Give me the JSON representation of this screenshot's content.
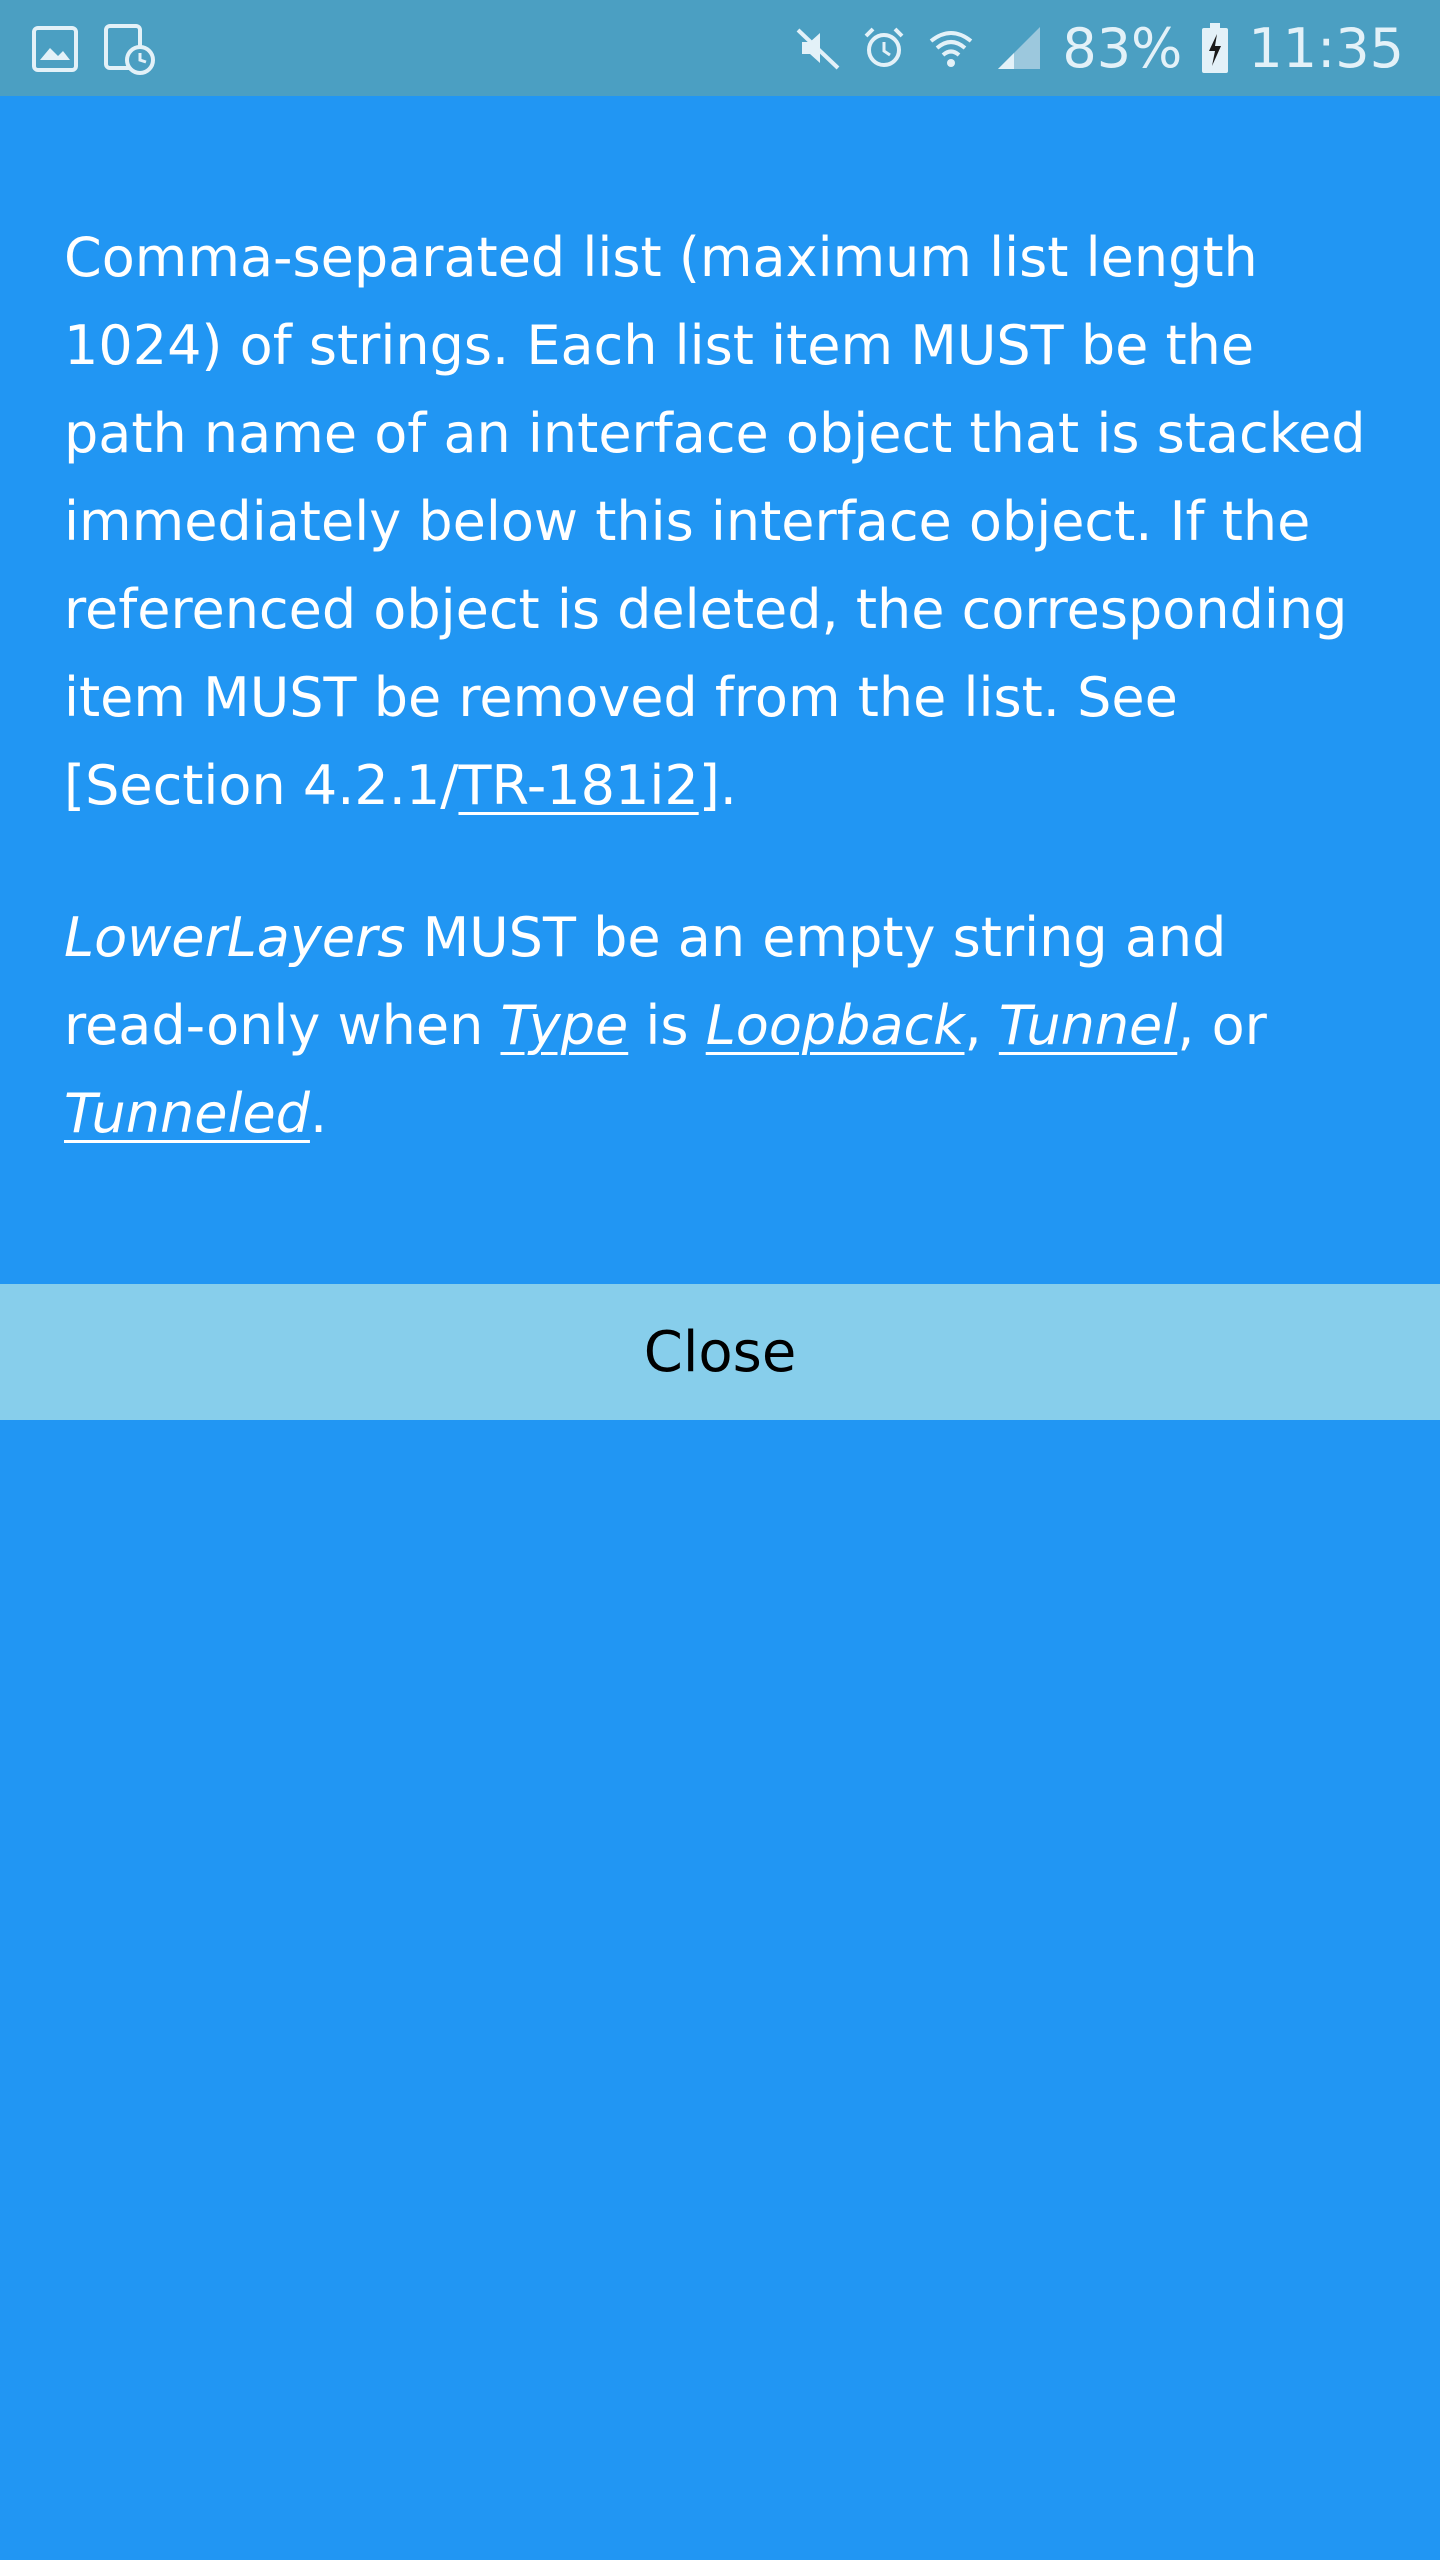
{
  "status_bar": {
    "battery_percent": "83%",
    "time": "11:35",
    "icons_left": [
      "gallery-icon",
      "screenshot-schedule-icon"
    ],
    "icons_right": [
      "mute-icon",
      "alarm-icon",
      "wifi-icon",
      "signal-icon",
      "battery-charging-icon"
    ]
  },
  "description": {
    "p1": {
      "text_main": "Comma-separated list (maximum list length 1024) of strings. Each list item MUST be the path name of an interface object that is stacked immediately below this interface object. If the referenced object is deleted, the corresponding item MUST be removed from the list. See [Section 4.2.1/",
      "link": "TR-181i2",
      "text_end": "]."
    },
    "p2": {
      "param_name": "LowerLayers",
      "text_a": " MUST be an empty string and read-only when ",
      "type_link": "Type",
      "text_b": " is ",
      "loopback_link": "Loopback",
      "comma1": ", ",
      "tunnel_link": "Tunnel",
      "text_c": ", or ",
      "tunneled_link": "Tunneled",
      "period": "."
    }
  },
  "close_button": {
    "label": "Close"
  },
  "colors": {
    "background": "#2196F3",
    "status_bar": "#4B9FC2",
    "close_bar": "#87CEEB",
    "text": "#FFFFFF"
  }
}
